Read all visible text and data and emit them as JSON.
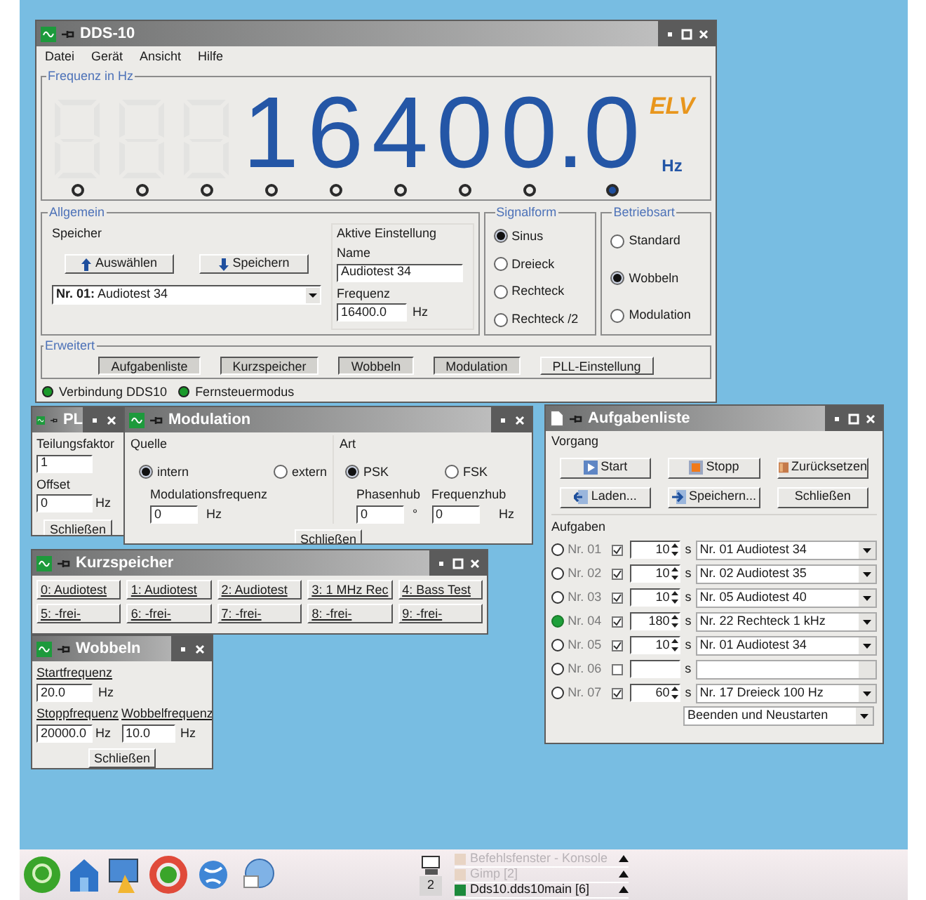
{
  "main_window": {
    "title": "DDS-10",
    "menu": [
      "Datei",
      "Gerät",
      "Ansicht",
      "Hilfe"
    ],
    "frequency_panel": {
      "legend": "Frequenz in Hz",
      "logo": "ELV",
      "unit": "Hz",
      "cells": [
        {
          "kind": "blank"
        },
        {
          "kind": "blank"
        },
        {
          "kind": "blank"
        },
        {
          "kind": "digit",
          "digit": "1"
        },
        {
          "kind": "digit",
          "digit": "6"
        },
        {
          "kind": "digit",
          "digit": "4"
        },
        {
          "kind": "digit",
          "digit": "0"
        },
        {
          "kind": "digit",
          "digit": "0"
        },
        {
          "kind": "point",
          "digit": "."
        },
        {
          "kind": "digit",
          "digit": "0"
        }
      ],
      "indicators": [
        {
          "selected": false
        },
        {
          "selected": false
        },
        {
          "selected": false
        },
        {
          "selected": false
        },
        {
          "selected": false
        },
        {
          "selected": false
        },
        {
          "selected": false
        },
        {
          "selected": false
        },
        {
          "selected": true
        }
      ]
    },
    "general": {
      "legend": "Allgemein",
      "memory_label": "Speicher",
      "select_button": "Auswählen",
      "save_button": "Speichern",
      "memory_select": "**Nr. 01:** Audiotest 34",
      "active_label": "Aktive Einstellung",
      "name_label": "Name",
      "name_value": "Audiotest 34",
      "frequency_label": "Frequenz",
      "frequency_value": "16400.0",
      "frequency_unit": "Hz"
    },
    "signal_form": {
      "legend": "Signalform",
      "options": [
        {
          "label": "Sinus",
          "selected": true
        },
        {
          "label": "Dreieck",
          "selected": false
        },
        {
          "label": "Rechteck",
          "selected": false
        },
        {
          "label": "Rechteck /2",
          "selected": false
        }
      ]
    },
    "mode": {
      "legend": "Betriebsart",
      "options": [
        {
          "label": "Standard",
          "selected": false
        },
        {
          "label": "Wobbeln",
          "selected": true
        },
        {
          "label": "Modulation",
          "selected": false
        }
      ]
    },
    "extended": {
      "legend": "Erweitert",
      "buttons": [
        {
          "label": "Aufgabenliste",
          "pressed": true
        },
        {
          "label": "Kurzspeicher",
          "pressed": true
        },
        {
          "label": "Wobbeln",
          "pressed": true
        },
        {
          "label": "Modulation",
          "pressed": true
        },
        {
          "label": "PLL-Einstellung",
          "pressed": false
        }
      ]
    },
    "status": [
      {
        "label": "Verbindung DDS10",
        "on": true
      },
      {
        "label": "Fernsteuermodus",
        "on": true
      }
    ]
  },
  "pll_window": {
    "title": "PL",
    "factor_label": "Teilungsfaktor",
    "factor_value": "1",
    "offset_label": "Offset",
    "offset_value": "0",
    "offset_unit": "Hz",
    "close_button": "Schließen"
  },
  "modulation_window": {
    "title": "Modulation",
    "source_label": "Quelle",
    "source_options": [
      {
        "label": "intern",
        "selected": true
      },
      {
        "label": "extern",
        "selected": false
      }
    ],
    "mod_freq_label": "Modulationsfrequenz",
    "mod_freq_value": "0",
    "mod_freq_unit": "Hz",
    "type_label": "Art",
    "type_options": [
      {
        "label": "PSK",
        "selected": true
      },
      {
        "label": "FSK",
        "selected": false
      }
    ],
    "phase_label": "Phasenhub",
    "phase_value": "0",
    "phase_unit": "°",
    "fsk_label": "Frequenzhub",
    "fsk_value": "0",
    "fsk_unit": "Hz",
    "close_button": "Schließen"
  },
  "memory_window": {
    "title": "Kurzspeicher",
    "slots": [
      "0: Audiotest",
      "1: Audiotest",
      "2: Audiotest",
      "3: 1 MHz Rec",
      "4: Bass Test",
      "5: -frei-",
      "6: -frei-",
      "7: -frei-",
      "8: -frei-",
      "9: -frei-"
    ]
  },
  "sweep_window": {
    "title": "Wobbeln",
    "start_label": "Startfrequenz",
    "start_value": "20.0",
    "start_unit": "Hz",
    "stop_label": "Stoppfrequenz",
    "stop_value": "20000.0",
    "stop_unit": "Hz",
    "rate_label": "Wobbelfrequenz",
    "rate_value": "10.0",
    "rate_unit": "Hz",
    "close_button": "Schließen"
  },
  "task_window": {
    "title": "Aufgabenliste",
    "process_label": "Vorgang",
    "buttons": [
      {
        "label": "Start",
        "kind": "play"
      },
      {
        "label": "Stopp",
        "kind": "stop"
      },
      {
        "label": "Zurücksetzen",
        "kind": "reset"
      },
      {
        "label": "Laden...",
        "kind": "load"
      },
      {
        "label": "Speichern...",
        "kind": "save"
      },
      {
        "label": "Schließen",
        "kind": "plain"
      }
    ],
    "tasks_label": "Aufgaben",
    "tasks": [
      {
        "label": "Nr. 01",
        "selected": false,
        "checked": true,
        "seconds": "10",
        "unit": "s",
        "entry": "Nr. 01 Audiotest 34"
      },
      {
        "label": "Nr. 02",
        "selected": false,
        "checked": true,
        "seconds": "10",
        "unit": "s",
        "entry": "Nr. 02 Audiotest 35"
      },
      {
        "label": "Nr. 03",
        "selected": false,
        "checked": true,
        "seconds": "10",
        "unit": "s",
        "entry": "Nr. 05 Audiotest 40"
      },
      {
        "label": "Nr. 04",
        "selected": true,
        "checked": true,
        "seconds": "180",
        "unit": "s",
        "entry": "Nr. 22 Rechteck 1 kHz"
      },
      {
        "label": "Nr. 05",
        "selected": false,
        "checked": true,
        "seconds": "10",
        "unit": "s",
        "entry": "Nr. 01 Audiotest 34"
      },
      {
        "label": "Nr. 06",
        "selected": false,
        "checked": false,
        "unit": "s"
      },
      {
        "label": "Nr. 07",
        "selected": false,
        "checked": true,
        "seconds": "60",
        "unit": "s",
        "entry": "Nr. 17 Dreieck 100 Hz"
      }
    ],
    "end_action": "Beenden und Neustarten"
  },
  "taskbar": {
    "desktop_number": "2",
    "tasks": [
      {
        "label": "Befehlsfenster - Konsole",
        "active": false
      },
      {
        "label": "Gimp [2]",
        "active": false
      },
      {
        "label": "Dds10.dds10main [6]",
        "active": true
      }
    ]
  }
}
